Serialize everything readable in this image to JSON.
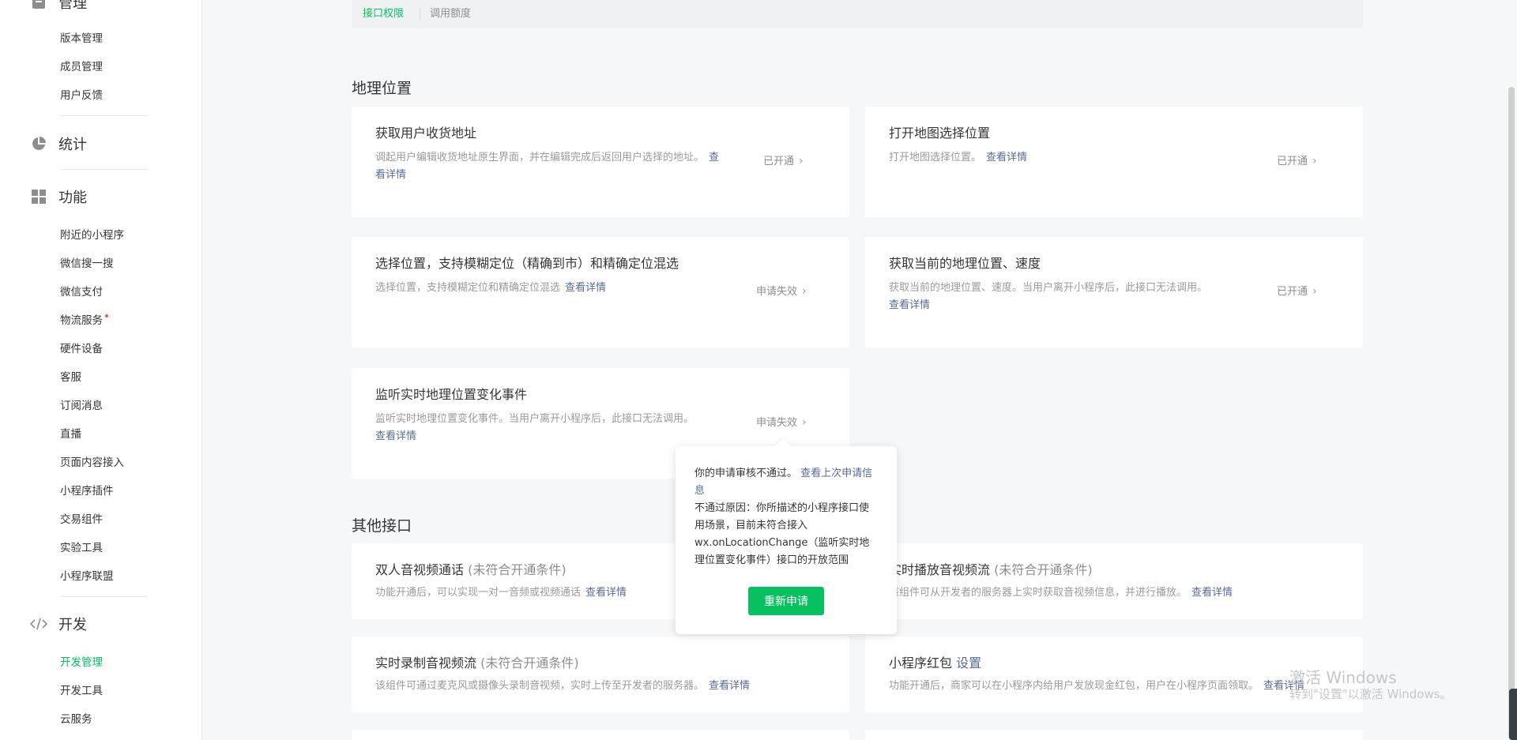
{
  "sidebar": {
    "manage_partial": "管理",
    "manage_items": [
      "版本管理",
      "成员管理",
      "用户反馈"
    ],
    "stats": {
      "label": "统计",
      "icon": "pie-chart-icon"
    },
    "features": {
      "label": "功能",
      "icon": "grid-icon",
      "items": [
        "附近的小程序",
        "微信搜一搜",
        "微信支付",
        "物流服务",
        "硬件设备",
        "客服",
        "订阅消息",
        "直播",
        "页面内容接入",
        "小程序插件",
        "交易组件",
        "实验工具",
        "小程序联盟"
      ]
    },
    "develop": {
      "label": "开发",
      "icon": "code-icon",
      "items": [
        "开发管理",
        "开发工具",
        "云服务"
      ]
    }
  },
  "tabs": {
    "active": "接口权限",
    "inactive": "调用额度"
  },
  "geo_section": {
    "title": "地理位置",
    "cards": [
      {
        "title": "获取用户收货地址",
        "desc": "调起用户编辑收货地址原生界面，并在编辑完成后返回用户选择的地址。",
        "link": "查看详情",
        "status": "已开通"
      },
      {
        "title": "打开地图选择位置",
        "desc": "打开地图选择位置。",
        "link": "查看详情",
        "status": "已开通"
      },
      {
        "title": "选择位置，支持模糊定位（精确到市）和精确定位混选",
        "desc": "选择位置，支持模糊定位和精确定位混选",
        "link": "查看详情",
        "status": "申请失效"
      },
      {
        "title": "获取当前的地理位置、速度",
        "desc": "获取当前的地理位置、速度。当用户离开小程序后，此接口无法调用。",
        "link": "查看详情",
        "status": "已开通"
      },
      {
        "title": "监听实时地理位置变化事件",
        "desc": "监听实时地理位置变化事件。当用户离开小程序后，此接口无法调用。",
        "link": "查看详情",
        "status": "申请失效"
      }
    ]
  },
  "other_section": {
    "title": "其他接口",
    "cards": [
      {
        "title": "双人音视频通话",
        "sub": "(未符合开通条件)",
        "desc": "功能开通后，可以实现一对一音频或视频通话",
        "link": "查看详情"
      },
      {
        "title": "实时播放音视频流",
        "sub": "(未符合开通条件)",
        "desc": "该组件可从开发者的服务器上实时获取音视频信息，并进行播放。",
        "link": "查看详情"
      },
      {
        "title": "实时录制音视频流",
        "sub": "(未符合开通条件)",
        "desc": "该组件可通过麦克风或摄像头录制音视频，实时上传至开发者的服务器。",
        "link": "查看详情"
      },
      {
        "title": "小程序红包",
        "title_link": "设置",
        "desc": "功能开通后，商家可以在小程序内给用户发放现金红包，用户在小程序页面领取。",
        "link": "查看详情"
      }
    ]
  },
  "popover": {
    "line1": "你的申请审核不通过。",
    "line1_link": "查看上次申请信息",
    "reason": "不通过原因：你所描述的小程序接口使用场景，目前未符合接入wx.onLocationChange（监听实时地理位置变化事件）接口的开放范围",
    "button": "重新申请"
  },
  "watermark": {
    "line1": "激活 Windows",
    "line2": "转到\"设置\"以激活 Windows。"
  },
  "colors": {
    "accent": "#07c160",
    "link": "#576b95",
    "badge_dot": "#fa5151"
  }
}
